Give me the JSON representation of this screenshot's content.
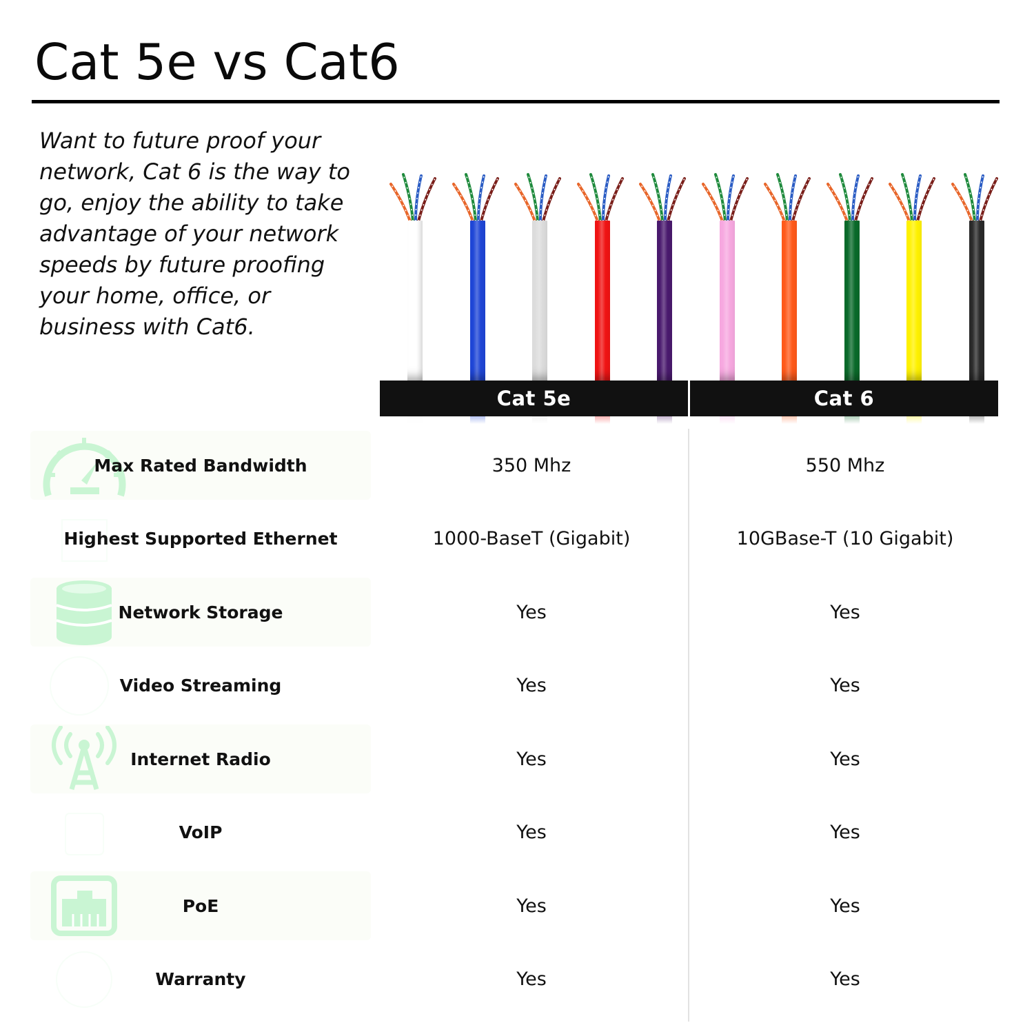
{
  "header": {
    "title": "Cat 5e vs Cat6"
  },
  "intro": {
    "text": "Want to future proof  your network, Cat 6 is the way to go, enjoy the ability to take advantage of  your network speeds by future proofing your home, office, or business with Cat6."
  },
  "cables": {
    "wire_pair_colors": [
      "#e8662a",
      "#1e8a3c",
      "#2a5cc4",
      "#7a1f1a"
    ],
    "groups": [
      {
        "label": "Cat 5e",
        "jacket_colors": [
          {
            "name": "white",
            "hex": "#f7f7f7"
          },
          {
            "name": "blue",
            "hex": "#1f46d6"
          },
          {
            "name": "gray",
            "hex": "#dcdcdc"
          },
          {
            "name": "red",
            "hex": "#f01414"
          },
          {
            "name": "purple",
            "hex": "#4a1a6e"
          }
        ]
      },
      {
        "label": "Cat 6",
        "jacket_colors": [
          {
            "name": "pink",
            "hex": "#f7a8e0"
          },
          {
            "name": "orange",
            "hex": "#ff5a1a"
          },
          {
            "name": "green",
            "hex": "#0a6a2a"
          },
          {
            "name": "yellow",
            "hex": "#fff200"
          },
          {
            "name": "black",
            "hex": "#2a2a2a"
          }
        ]
      }
    ]
  },
  "comparison": {
    "columns": [
      "Cat 5e",
      "Cat 6"
    ],
    "icon_color": "#c9f5d3",
    "rows": [
      {
        "feature": "Max Rated Bandwidth",
        "icon": "speedometer-icon",
        "cat5e": "350 Mhz",
        "cat6": "550 Mhz"
      },
      {
        "feature": "Highest Supported Ethernet",
        "icon": "ethernet-icon",
        "cat5e": "1000-BaseT (Gigabit)",
        "cat6": "10GBase-T (10 Gigabit)"
      },
      {
        "feature": "Network Storage",
        "icon": "database-icon",
        "cat5e": "Yes",
        "cat6": "Yes"
      },
      {
        "feature": "Video Streaming",
        "icon": "play-icon",
        "cat5e": "Yes",
        "cat6": "Yes"
      },
      {
        "feature": "Internet Radio",
        "icon": "radio-tower-icon",
        "cat5e": "Yes",
        "cat6": "Yes"
      },
      {
        "feature": "VoIP",
        "icon": "phone-icon",
        "cat5e": "Yes",
        "cat6": "Yes"
      },
      {
        "feature": "PoE",
        "icon": "rj45-port-icon",
        "cat5e": "Yes",
        "cat6": "Yes"
      },
      {
        "feature": "Warranty",
        "icon": "badge-icon",
        "cat5e": "Yes",
        "cat6": "Yes"
      }
    ]
  }
}
